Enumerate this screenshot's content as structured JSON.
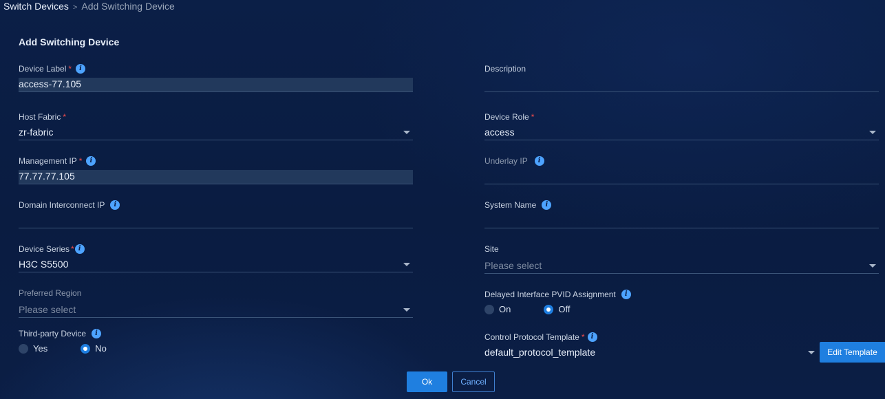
{
  "breadcrumb": {
    "root": "Switch Devices",
    "separator": ">",
    "current": "Add Switching Device"
  },
  "form": {
    "title": "Add Switching Device",
    "device_label": {
      "label": "Device Label",
      "value": "access-77.105"
    },
    "description": {
      "label": "Description",
      "value": ""
    },
    "host_fabric": {
      "label": "Host Fabric",
      "value": "zr-fabric"
    },
    "device_role": {
      "label": "Device Role",
      "value": "access"
    },
    "management_ip": {
      "label": "Management IP",
      "value": "77.77.77.105"
    },
    "underlay_ip": {
      "label": "Underlay IP",
      "value": ""
    },
    "domain_interconnect_ip": {
      "label": "Domain Interconnect IP",
      "value": ""
    },
    "system_name": {
      "label": "System Name",
      "value": ""
    },
    "device_series": {
      "label": "Device Series",
      "value": "H3C S5500"
    },
    "site": {
      "label": "Site",
      "placeholder": "Please select"
    },
    "preferred_region": {
      "label": "Preferred Region",
      "placeholder": "Please select"
    },
    "delayed_pvid": {
      "label": "Delayed Interface PVID Assignment",
      "options": [
        "On",
        "Off"
      ],
      "selected": "Off"
    },
    "third_party": {
      "label": "Third-party Device",
      "options": [
        "Yes",
        "No"
      ],
      "selected": "No"
    },
    "control_protocol_template": {
      "label": "Control Protocol Template",
      "value": "default_protocol_template"
    },
    "required_mark": "*",
    "info_glyph": "i"
  },
  "buttons": {
    "ok": "Ok",
    "cancel": "Cancel",
    "edit_template": "Edit Template"
  }
}
